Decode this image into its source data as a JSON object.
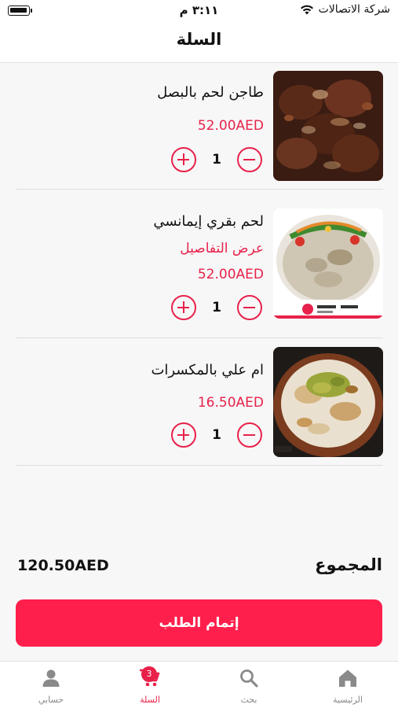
{
  "status_bar": {
    "time": "٣:١١ م",
    "carrier": "شركة الاتصالات"
  },
  "header": {
    "title": "السلة"
  },
  "cart": {
    "items": [
      {
        "name": "طاجن لحم بالبصل",
        "details_link": "",
        "price": "52.00AED",
        "quantity": "1",
        "image": "beef-stew-image"
      },
      {
        "name": "لحم بقري إيمانسي",
        "details_link": "عرض التفاصيل",
        "price": "52.00AED",
        "quantity": "1",
        "image": "beef-emince-image"
      },
      {
        "name": "ام علي بالمكسرات",
        "details_link": "",
        "price": "16.50AED",
        "quantity": "1",
        "image": "om-ali-image"
      }
    ]
  },
  "summary": {
    "total_label": "المجموع",
    "total_value": "120.50AED"
  },
  "checkout": {
    "label": "إتمام الطلب"
  },
  "tab_bar": {
    "tabs": [
      {
        "label": "الرئيسية",
        "icon": "home-icon"
      },
      {
        "label": "بحث",
        "icon": "search-icon"
      },
      {
        "label": "السلة",
        "icon": "cart-icon",
        "badge": "3"
      },
      {
        "label": "حسابي",
        "icon": "user-icon"
      }
    ]
  },
  "colors": {
    "accent": "#e8214a",
    "button": "#ff1f4c",
    "background": "#f7f7f7"
  }
}
